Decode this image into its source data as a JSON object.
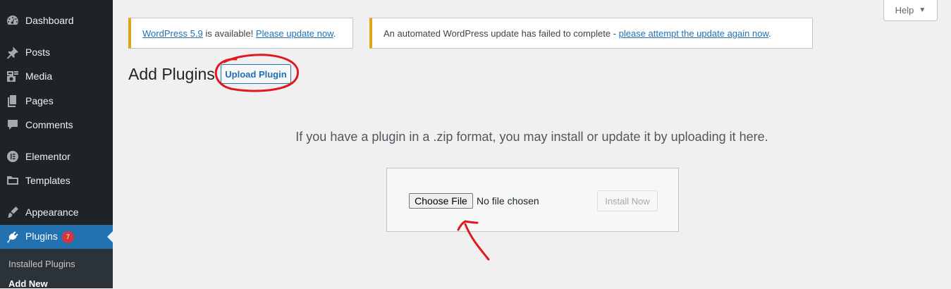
{
  "sidebar": {
    "items": [
      {
        "label": "Dashboard",
        "icon": "dashboard-icon"
      },
      {
        "label": "Posts",
        "icon": "pin-icon"
      },
      {
        "label": "Media",
        "icon": "media-icon"
      },
      {
        "label": "Pages",
        "icon": "pages-icon"
      },
      {
        "label": "Comments",
        "icon": "comment-icon"
      },
      {
        "label": "Elementor",
        "icon": "elementor-icon"
      },
      {
        "label": "Templates",
        "icon": "folder-icon"
      },
      {
        "label": "Appearance",
        "icon": "brush-icon"
      },
      {
        "label": "Plugins",
        "icon": "plug-icon",
        "badge": "7",
        "current": true
      }
    ],
    "submenu": [
      {
        "label": "Installed Plugins"
      },
      {
        "label": "Add New",
        "active": true
      }
    ]
  },
  "help": {
    "label": "Help",
    "caret": "▼"
  },
  "notices": {
    "update": {
      "link1": "WordPress 5.9",
      "text": " is available! ",
      "link2": "Please update now",
      "end": "."
    },
    "failed": {
      "text": "An automated WordPress update has failed to complete - ",
      "link": "please attempt the update again now",
      "end": "."
    }
  },
  "page": {
    "title": "Add Plugins",
    "upload_button": "Upload Plugin",
    "upload_help": "If you have a plugin in a .zip format, you may install or update it by uploading it here.",
    "choose_file": "Choose File",
    "no_file": "No file chosen",
    "install_now": "Install Now"
  },
  "colors": {
    "sidebar_bg": "#1d2327",
    "accent": "#2271b1",
    "notice_border": "#dba617",
    "annotation": "#e0191f"
  }
}
